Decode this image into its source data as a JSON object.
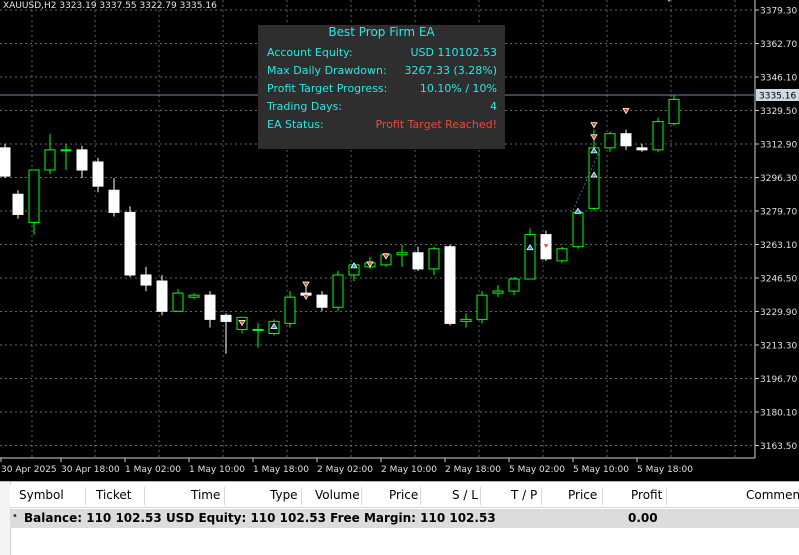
{
  "chart": {
    "symbol_info": "XAUUSD,H2  3323.19 3337.55 3322.79 3335.16",
    "current_price_label": "3335.16",
    "price_axis": [
      "3379.30",
      "3362.70",
      "3346.10",
      "3329.50",
      "3312.90",
      "3296.30",
      "3279.70",
      "3263.10",
      "3246.50",
      "3229.90",
      "3213.30",
      "3196.70",
      "3180.10",
      "3163.50"
    ],
    "time_axis": [
      "30 Apr 2025",
      "30 Apr 18:00",
      "1 May 02:00",
      "1 May 10:00",
      "1 May 18:00",
      "2 May 02:00",
      "2 May 10:00",
      "2 May 18:00",
      "5 May 02:00",
      "5 May 10:00",
      "5 May 18:00"
    ],
    "colors": {
      "background": "#000000",
      "grid": "#8a8a8a",
      "bull_candle": "#00ff00",
      "bear_candle": "#ffffff",
      "price_line": "#6a8bb0"
    }
  },
  "ea_panel": {
    "title": "Best Prop Firm EA",
    "rows": [
      {
        "label": "Account Equity:",
        "value": "USD 110102.53"
      },
      {
        "label": "Max Daily Drawdown:",
        "value": "3267.33 (3.28%)"
      },
      {
        "label": "Profit Target Progress:",
        "value": "10.10% / 10%"
      },
      {
        "label": "Trading Days:",
        "value": "4"
      },
      {
        "label": "EA Status:",
        "value": "Profit Target Reached!"
      }
    ],
    "colors": {
      "text": "#2ee6e6",
      "status": "#e84b3c",
      "background": "#2e2e2e"
    }
  },
  "terminal": {
    "columns": [
      "Symbol",
      "Ticket",
      "Time",
      "Type",
      "Volume",
      "Price",
      "S / L",
      "T / P",
      "Price",
      "Profit",
      "Comment"
    ],
    "summary": "Balance: 110 102.53 USD  Equity: 110 102.53  Free Margin: 110 102.53",
    "profit": "0.00"
  }
}
